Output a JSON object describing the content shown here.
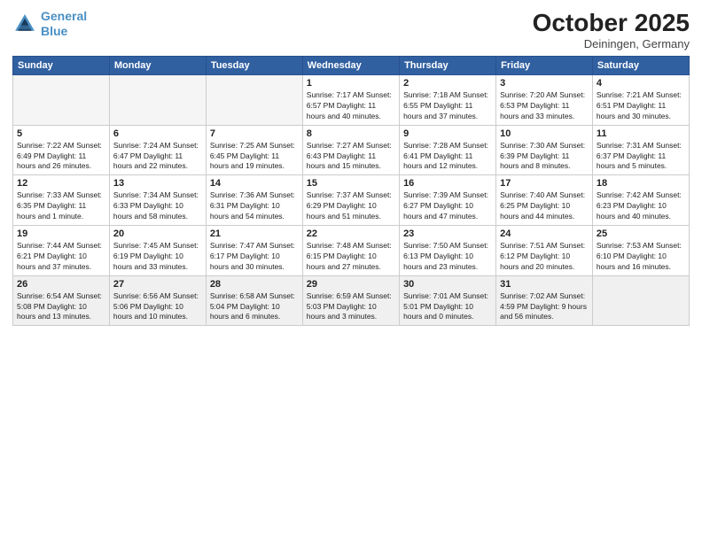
{
  "logo": {
    "line1": "General",
    "line2": "Blue"
  },
  "title": "October 2025",
  "location": "Deiningen, Germany",
  "weekdays": [
    "Sunday",
    "Monday",
    "Tuesday",
    "Wednesday",
    "Thursday",
    "Friday",
    "Saturday"
  ],
  "weeks": [
    [
      {
        "day": "",
        "info": ""
      },
      {
        "day": "",
        "info": ""
      },
      {
        "day": "",
        "info": ""
      },
      {
        "day": "1",
        "info": "Sunrise: 7:17 AM\nSunset: 6:57 PM\nDaylight: 11 hours\nand 40 minutes."
      },
      {
        "day": "2",
        "info": "Sunrise: 7:18 AM\nSunset: 6:55 PM\nDaylight: 11 hours\nand 37 minutes."
      },
      {
        "day": "3",
        "info": "Sunrise: 7:20 AM\nSunset: 6:53 PM\nDaylight: 11 hours\nand 33 minutes."
      },
      {
        "day": "4",
        "info": "Sunrise: 7:21 AM\nSunset: 6:51 PM\nDaylight: 11 hours\nand 30 minutes."
      }
    ],
    [
      {
        "day": "5",
        "info": "Sunrise: 7:22 AM\nSunset: 6:49 PM\nDaylight: 11 hours\nand 26 minutes."
      },
      {
        "day": "6",
        "info": "Sunrise: 7:24 AM\nSunset: 6:47 PM\nDaylight: 11 hours\nand 22 minutes."
      },
      {
        "day": "7",
        "info": "Sunrise: 7:25 AM\nSunset: 6:45 PM\nDaylight: 11 hours\nand 19 minutes."
      },
      {
        "day": "8",
        "info": "Sunrise: 7:27 AM\nSunset: 6:43 PM\nDaylight: 11 hours\nand 15 minutes."
      },
      {
        "day": "9",
        "info": "Sunrise: 7:28 AM\nSunset: 6:41 PM\nDaylight: 11 hours\nand 12 minutes."
      },
      {
        "day": "10",
        "info": "Sunrise: 7:30 AM\nSunset: 6:39 PM\nDaylight: 11 hours\nand 8 minutes."
      },
      {
        "day": "11",
        "info": "Sunrise: 7:31 AM\nSunset: 6:37 PM\nDaylight: 11 hours\nand 5 minutes."
      }
    ],
    [
      {
        "day": "12",
        "info": "Sunrise: 7:33 AM\nSunset: 6:35 PM\nDaylight: 11 hours\nand 1 minute."
      },
      {
        "day": "13",
        "info": "Sunrise: 7:34 AM\nSunset: 6:33 PM\nDaylight: 10 hours\nand 58 minutes."
      },
      {
        "day": "14",
        "info": "Sunrise: 7:36 AM\nSunset: 6:31 PM\nDaylight: 10 hours\nand 54 minutes."
      },
      {
        "day": "15",
        "info": "Sunrise: 7:37 AM\nSunset: 6:29 PM\nDaylight: 10 hours\nand 51 minutes."
      },
      {
        "day": "16",
        "info": "Sunrise: 7:39 AM\nSunset: 6:27 PM\nDaylight: 10 hours\nand 47 minutes."
      },
      {
        "day": "17",
        "info": "Sunrise: 7:40 AM\nSunset: 6:25 PM\nDaylight: 10 hours\nand 44 minutes."
      },
      {
        "day": "18",
        "info": "Sunrise: 7:42 AM\nSunset: 6:23 PM\nDaylight: 10 hours\nand 40 minutes."
      }
    ],
    [
      {
        "day": "19",
        "info": "Sunrise: 7:44 AM\nSunset: 6:21 PM\nDaylight: 10 hours\nand 37 minutes."
      },
      {
        "day": "20",
        "info": "Sunrise: 7:45 AM\nSunset: 6:19 PM\nDaylight: 10 hours\nand 33 minutes."
      },
      {
        "day": "21",
        "info": "Sunrise: 7:47 AM\nSunset: 6:17 PM\nDaylight: 10 hours\nand 30 minutes."
      },
      {
        "day": "22",
        "info": "Sunrise: 7:48 AM\nSunset: 6:15 PM\nDaylight: 10 hours\nand 27 minutes."
      },
      {
        "day": "23",
        "info": "Sunrise: 7:50 AM\nSunset: 6:13 PM\nDaylight: 10 hours\nand 23 minutes."
      },
      {
        "day": "24",
        "info": "Sunrise: 7:51 AM\nSunset: 6:12 PM\nDaylight: 10 hours\nand 20 minutes."
      },
      {
        "day": "25",
        "info": "Sunrise: 7:53 AM\nSunset: 6:10 PM\nDaylight: 10 hours\nand 16 minutes."
      }
    ],
    [
      {
        "day": "26",
        "info": "Sunrise: 6:54 AM\nSunset: 5:08 PM\nDaylight: 10 hours\nand 13 minutes."
      },
      {
        "day": "27",
        "info": "Sunrise: 6:56 AM\nSunset: 5:06 PM\nDaylight: 10 hours\nand 10 minutes."
      },
      {
        "day": "28",
        "info": "Sunrise: 6:58 AM\nSunset: 5:04 PM\nDaylight: 10 hours\nand 6 minutes."
      },
      {
        "day": "29",
        "info": "Sunrise: 6:59 AM\nSunset: 5:03 PM\nDaylight: 10 hours\nand 3 minutes."
      },
      {
        "day": "30",
        "info": "Sunrise: 7:01 AM\nSunset: 5:01 PM\nDaylight: 10 hours\nand 0 minutes."
      },
      {
        "day": "31",
        "info": "Sunrise: 7:02 AM\nSunset: 4:59 PM\nDaylight: 9 hours\nand 56 minutes."
      },
      {
        "day": "",
        "info": ""
      }
    ]
  ]
}
